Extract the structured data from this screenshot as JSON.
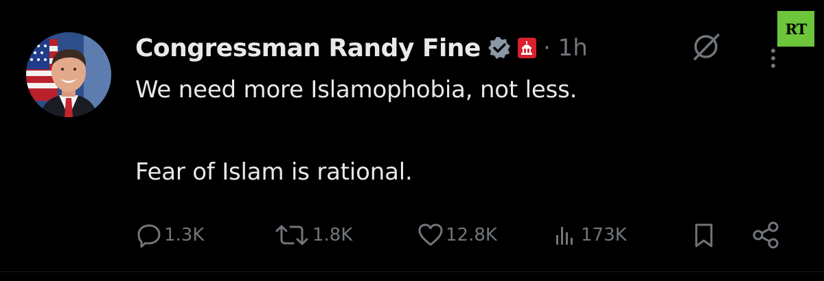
{
  "watermark": {
    "text": "RT",
    "bg": "#6cc53a"
  },
  "author": {
    "display_name": "Congressman Randy Fine",
    "timestamp": "1h",
    "separator": "·",
    "verified_color": "#8b98a5",
    "gov_badge_color": "#d9202e"
  },
  "tweet": {
    "lines": [
      "We need more Islamophobia, not less.",
      "Fear of Islam is rational."
    ]
  },
  "actions": {
    "replies": "1.3K",
    "reposts": "1.8K",
    "likes": "12.8K",
    "views": "173K"
  },
  "icons": {
    "avatar": "avatar",
    "verified": "verified-badge-icon",
    "government": "capitol-icon",
    "grok": "grok-icon",
    "more": "more-icon",
    "reply": "reply-icon",
    "repost": "repost-icon",
    "like": "heart-icon",
    "views": "views-icon",
    "bookmark": "bookmark-icon",
    "share": "share-icon"
  },
  "colors": {
    "background": "#000000",
    "text": "#e7e9ea",
    "muted": "#71767b"
  }
}
